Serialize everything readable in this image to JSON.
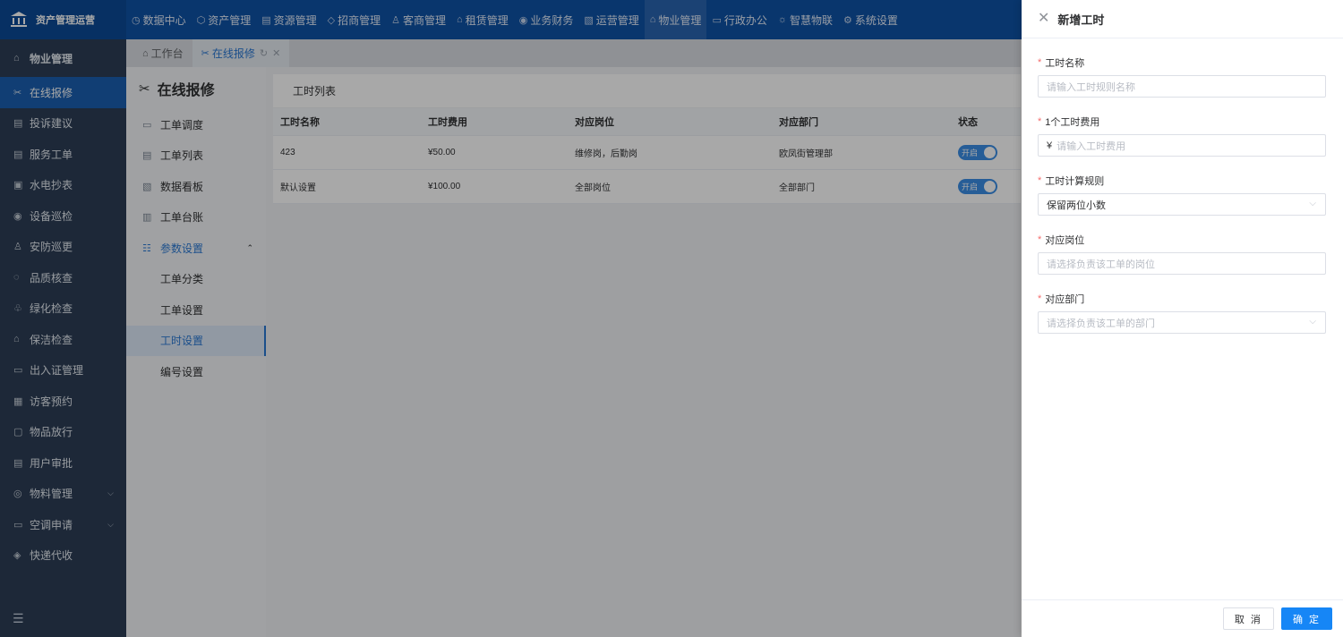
{
  "app": {
    "title": "资产管理运营"
  },
  "topnav": [
    {
      "label": "数据中心",
      "icon": "clock-icon"
    },
    {
      "label": "资产管理",
      "icon": "cube-icon"
    },
    {
      "label": "资源管理",
      "icon": "building-icon"
    },
    {
      "label": "招商管理",
      "icon": "tag-icon"
    },
    {
      "label": "客商管理",
      "icon": "users-icon"
    },
    {
      "label": "租赁管理",
      "icon": "home-icon"
    },
    {
      "label": "业务财务",
      "icon": "coin-icon"
    },
    {
      "label": "运营管理",
      "icon": "chart-icon"
    },
    {
      "label": "物业管理",
      "icon": "house-icon"
    },
    {
      "label": "行政办公",
      "icon": "monitor-icon"
    },
    {
      "label": "智慧物联",
      "icon": "sun-icon"
    },
    {
      "label": "系统设置",
      "icon": "gear-icon"
    }
  ],
  "sidebar": {
    "header": "物业管理",
    "items": [
      {
        "label": "在线报修"
      },
      {
        "label": "投诉建议"
      },
      {
        "label": "服务工单"
      },
      {
        "label": "水电抄表"
      },
      {
        "label": "设备巡检"
      },
      {
        "label": "安防巡更"
      },
      {
        "label": "品质核查"
      },
      {
        "label": "绿化检查"
      },
      {
        "label": "保洁检查"
      },
      {
        "label": "出入证管理"
      },
      {
        "label": "访客预约"
      },
      {
        "label": "物品放行"
      },
      {
        "label": "用户审批"
      },
      {
        "label": "物料管理"
      },
      {
        "label": "空调申请"
      },
      {
        "label": "快递代收"
      }
    ]
  },
  "tabs": [
    {
      "label": "工作台"
    },
    {
      "label": "在线报修"
    }
  ],
  "subnav": {
    "title": "在线报修",
    "items": [
      {
        "label": "工单调度"
      },
      {
        "label": "工单列表"
      },
      {
        "label": "数据看板"
      },
      {
        "label": "工单台账"
      },
      {
        "label": "参数设置"
      },
      {
        "label": "工单分类"
      },
      {
        "label": "工单设置"
      },
      {
        "label": "工时设置"
      },
      {
        "label": "编号设置"
      }
    ]
  },
  "table": {
    "title": "工时列表",
    "columns": [
      "工时名称",
      "工时费用",
      "对应岗位",
      "对应部门",
      "状态"
    ],
    "rows": [
      {
        "name": "423",
        "fee": "¥50.00",
        "post": "维修岗，后勤岗",
        "dept": "欧凤街管理部",
        "status": "开启"
      },
      {
        "name": "默认设置",
        "fee": "¥100.00",
        "post": "全部岗位",
        "dept": "全部部门",
        "status": "开启"
      }
    ]
  },
  "drawer": {
    "title": "新增工时",
    "fields": [
      {
        "label": "工时名称",
        "placeholder": "请输入工时规则名称",
        "value": ""
      },
      {
        "label": "1个工时费用",
        "prefix": "¥",
        "placeholder": "请输入工时费用",
        "value": ""
      },
      {
        "label": "工时计算规则",
        "value": "保留两位小数"
      },
      {
        "label": "对应岗位",
        "placeholder": "请选择负责该工单的岗位",
        "value": ""
      },
      {
        "label": "对应部门",
        "placeholder": "请选择负责该工单的部门",
        "value": ""
      }
    ],
    "cancel": "取 消",
    "ok": "确 定"
  },
  "colors": {
    "topbar": "#0f53a6",
    "sidebar": "#2c3e56",
    "accent": "#1686f6",
    "required": "#f56c6c"
  }
}
